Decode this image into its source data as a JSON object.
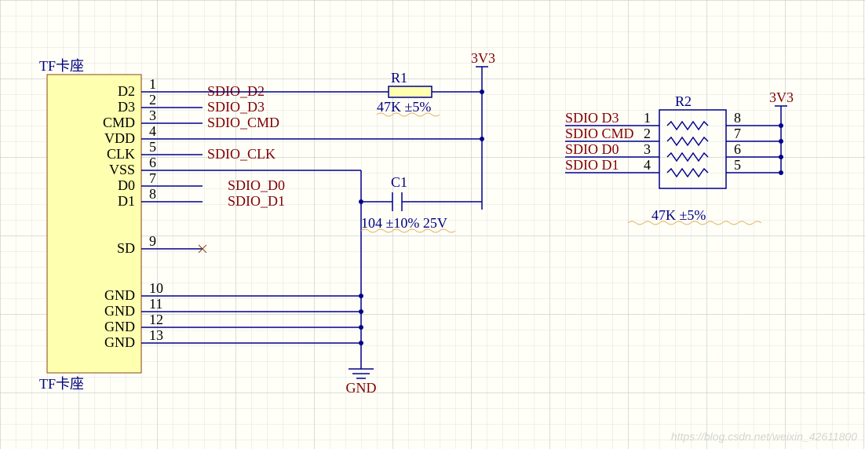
{
  "tf_socket": {
    "title_top": "TF卡座",
    "title_bottom": "TF卡座",
    "pins": [
      {
        "num": "1",
        "name": "D2",
        "net": "SDIO_D2"
      },
      {
        "num": "2",
        "name": "D3",
        "net": "SDIO_D3"
      },
      {
        "num": "3",
        "name": "CMD",
        "net": "SDIO_CMD"
      },
      {
        "num": "4",
        "name": "VDD",
        "net": ""
      },
      {
        "num": "5",
        "name": "CLK",
        "net": "SDIO_CLK"
      },
      {
        "num": "6",
        "name": "VSS",
        "net": ""
      },
      {
        "num": "7",
        "name": "D0",
        "net": "SDIO_D0"
      },
      {
        "num": "8",
        "name": "D1",
        "net": "SDIO_D1"
      },
      {
        "num": "9",
        "name": "SD",
        "net": ""
      },
      {
        "num": "10",
        "name": "GND",
        "net": ""
      },
      {
        "num": "11",
        "name": "GND",
        "net": ""
      },
      {
        "num": "12",
        "name": "GND",
        "net": ""
      },
      {
        "num": "13",
        "name": "GND",
        "net": ""
      }
    ]
  },
  "r1": {
    "ref": "R1",
    "value": "47K ±5%"
  },
  "c1": {
    "ref": "C1",
    "value": "104 ±10% 25V"
  },
  "r2": {
    "ref": "R2",
    "value": "47K ±5%",
    "left_nets": [
      "SDIO D3",
      "SDIO CMD",
      "SDIO D0",
      "SDIO D1"
    ],
    "left_nums": [
      "1",
      "2",
      "3",
      "4"
    ],
    "right_nums": [
      "8",
      "7",
      "6",
      "5"
    ]
  },
  "power": {
    "v3v3": "3V3",
    "gnd": "GND"
  },
  "watermark": "https://blog.csdn.net/weixin_42611800"
}
